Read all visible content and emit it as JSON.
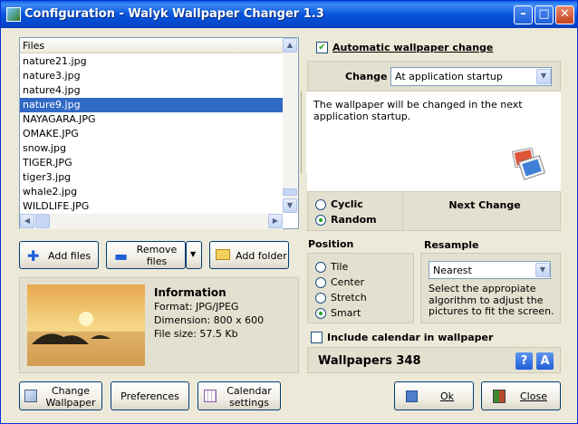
{
  "window": {
    "title": "Configuration - Walyk Wallpaper Changer 1.3"
  },
  "files": {
    "header": "Files",
    "items": [
      "nature21.jpg",
      "nature3.jpg",
      "nature4.jpg",
      "nature9.jpg",
      "NAYAGARA.JPG",
      "OMAKE.JPG",
      "snow.jpg",
      "TIGER.JPG",
      "tiger3.jpg",
      "whale2.jpg",
      "WILDLIFE.JPG"
    ],
    "selected": "nature9.jpg",
    "add_files": "Add files",
    "remove_files": "Remove files",
    "add_folder": "Add folder"
  },
  "info": {
    "heading": "Information",
    "format": "Format: JPG/JPEG",
    "dimension": "Dimension: 800 x 600",
    "file_size": "File size: 57.5 Kb"
  },
  "auto": {
    "checkbox_label": "Automatic wallpaper change",
    "checked": true
  },
  "change": {
    "label": "Change",
    "selected": "At application startup",
    "description": "The wallpaper will be changed in the next application startup."
  },
  "order": {
    "cyclic": "Cyclic",
    "random": "Random",
    "selected": "Random",
    "next_change": "Next Change"
  },
  "position": {
    "heading": "Position",
    "options": [
      "Tile",
      "Center",
      "Stretch",
      "Smart"
    ],
    "selected": "Smart"
  },
  "resample": {
    "heading": "Resample",
    "selected": "Nearest",
    "description": "Select the appropiate algorithm to adjust the pictures to fit the screen."
  },
  "calendar": {
    "label": "Include calendar in wallpaper",
    "checked": false
  },
  "wallpapers": {
    "label": "Wallpapers 348"
  },
  "buttons": {
    "change_wallpaper": "Change Wallpaper",
    "preferences": "Preferences",
    "calendar_settings": "Calendar settings",
    "ok": "Ok",
    "close": "Close"
  },
  "colors": {
    "titlebar": "#0855dd",
    "selection": "#316ac5",
    "accent_green": "#21a121"
  }
}
